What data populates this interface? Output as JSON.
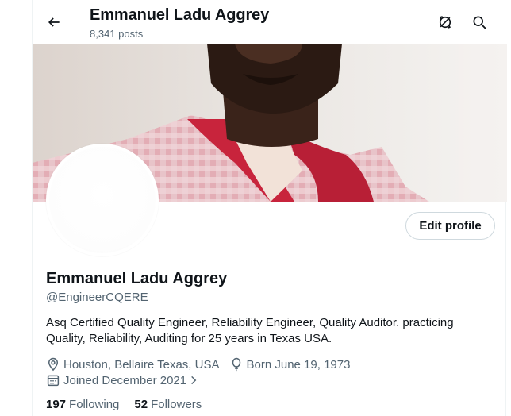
{
  "header": {
    "title": "Emmanuel Ladu Aggrey",
    "posts_count": "8,341 posts",
    "back_icon": "arrow-left-icon",
    "secondary_icons": [
      "no-data-saver-icon",
      "search-icon"
    ]
  },
  "profile": {
    "display_name": "Emmanuel Ladu Aggrey",
    "handle": "@EngineerCQERE",
    "edit_profile_label": "Edit profile",
    "bio": "Asq Certified Quality Engineer, Reliability Engineer, Quality Auditor. practicing Quality, Reliability, Auditing for 25 years in Texas USA.",
    "location": "Houston, Bellaire Texas, USA",
    "birthday": "Born June 19, 1973",
    "joined": "Joined December 2021",
    "following_count": "197",
    "following_label": "Following",
    "followers_count": "52",
    "followers_label": "Followers"
  },
  "colors": {
    "text_primary": "#0f1419",
    "text_secondary": "#536471",
    "border": "#cfd9de"
  }
}
